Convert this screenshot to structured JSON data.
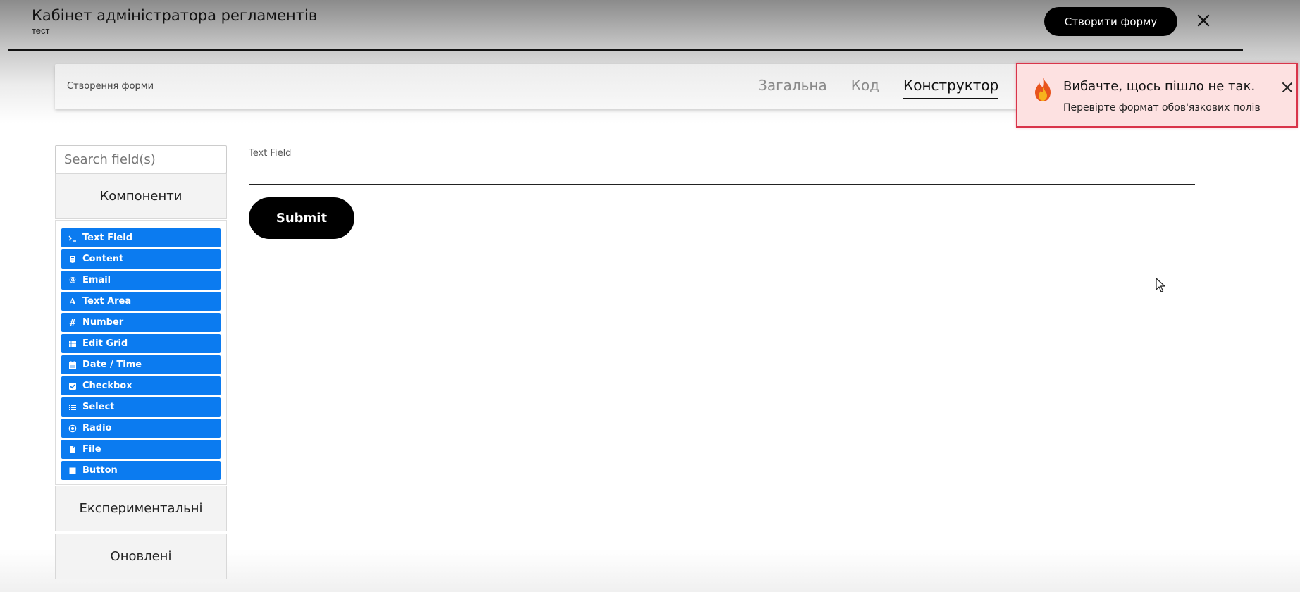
{
  "header": {
    "title": "Кабінет адміністратора регламентів",
    "subtitle": "тест",
    "create_button": "Створити форму"
  },
  "subheader": {
    "title": "Створення форми",
    "tabs": [
      {
        "label": "Загальна",
        "active": false
      },
      {
        "label": "Код",
        "active": false
      },
      {
        "label": "Конструктор",
        "active": true
      }
    ]
  },
  "toast": {
    "title": "Вибачте, щось пішло не так.",
    "message": "Перевірте формат обов'язкових полів",
    "icon": "fire-icon",
    "border_color": "#d9344a",
    "background": "#fde1e1"
  },
  "sidebar": {
    "search_placeholder": "Search field(s)",
    "groups": {
      "components": "Компоненти",
      "experimental": "Експериментальні",
      "updated": "Оновлені"
    },
    "components": [
      {
        "label": "Text Field",
        "icon": "terminal-icon"
      },
      {
        "label": "Content",
        "icon": "html5-icon"
      },
      {
        "label": "Email",
        "icon": "at-icon"
      },
      {
        "label": "Text Area",
        "icon": "font-icon"
      },
      {
        "label": "Number",
        "icon": "hashtag-icon"
      },
      {
        "label": "Edit Grid",
        "icon": "grid-icon"
      },
      {
        "label": "Date / Time",
        "icon": "calendar-icon"
      },
      {
        "label": "Checkbox",
        "icon": "check-square-icon"
      },
      {
        "label": "Select",
        "icon": "list-icon"
      },
      {
        "label": "Radio",
        "icon": "dot-circle-icon"
      },
      {
        "label": "File",
        "icon": "file-icon"
      },
      {
        "label": "Button",
        "icon": "stop-icon"
      }
    ],
    "component_color": "#0b7bf0"
  },
  "form": {
    "field_label": "Text Field",
    "field_value": "",
    "submit_label": "Submit"
  }
}
